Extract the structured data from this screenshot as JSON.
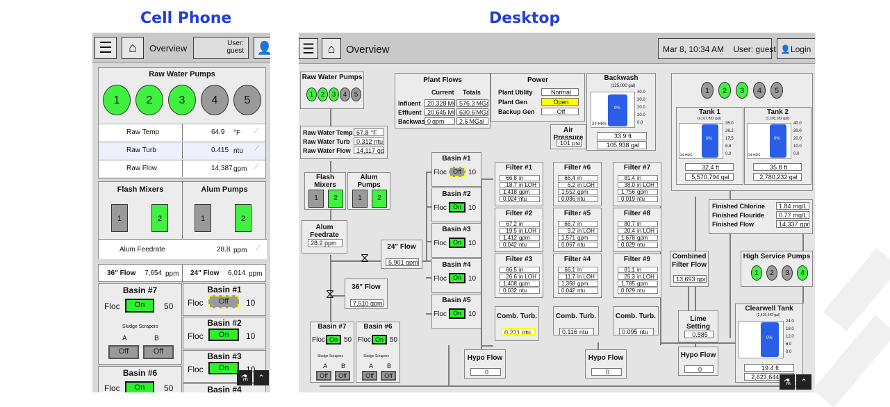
{
  "headings": {
    "cell": "Cell Phone",
    "desktop": "Desktop"
  },
  "phone": {
    "overview": "Overview",
    "user_label": "User:",
    "user_name": "guest",
    "raw_pumps_title": "Raw Water Pumps",
    "pump_numbers": [
      "1",
      "2",
      "3",
      "4",
      "5"
    ],
    "pump_colors": [
      "#3ff23f",
      "#3ff23f",
      "#3ff23f",
      "#9a9a9a",
      "#9a9a9a"
    ],
    "raw_rows": [
      {
        "label": "Raw Temp",
        "value": "64.9",
        "unit": "°F"
      },
      {
        "label": "Raw Turb",
        "value": "0.415",
        "unit": "ntu"
      },
      {
        "label": "Raw Flow",
        "value": "14,387",
        "unit": "gpm"
      }
    ],
    "flash_title": "Flash Mixers",
    "alum_title": "Alum Pumps",
    "flash": [
      "1",
      "2"
    ],
    "alum": [
      "1",
      "2"
    ],
    "feedrate_label": "Alum Feedrate",
    "feedrate_value": "28.8",
    "feedrate_unit": "ppm",
    "flow36_label": "36\" Flow",
    "flow36_value": "7,654",
    "flow36_unit": "ppm",
    "flow24_label": "24\" Flow",
    "flow24_value": "6,014",
    "flow24_unit": "ppm",
    "basin7": "Basin #7",
    "basin6": "Basin #6",
    "floc": "Floc",
    "on": "On",
    "off": "Off",
    "floc50": "50",
    "floc10": "10",
    "sludge": "Sludge Scrapers",
    "a": "A",
    "b": "B",
    "basin1": "Basin #1",
    "basin2": "Basin #2",
    "basin3": "Basin #3",
    "basin4": "Basin #4"
  },
  "desktop": {
    "overview": "Overview",
    "datetime": "Mar 8, 10:34 AM",
    "user": "User: guest",
    "login": "Login",
    "raw_pumps": "Raw Water Pumps",
    "pump_numbers": [
      "1",
      "2",
      "3",
      "4",
      "5"
    ],
    "plant_flows": "Plant Flows",
    "current": "Current",
    "totals": "Totals",
    "flows": [
      {
        "label": "Influent",
        "cur": "20.328",
        "cu": "MGD",
        "tot": "576.3",
        "tu": "MGal"
      },
      {
        "label": "Effluent",
        "cur": "20.645",
        "cu": "MGD",
        "tot": "630.6",
        "tu": "MGal"
      },
      {
        "label": "Backwash",
        "cur": "0",
        "cu": "gpm",
        "tot": "2.6",
        "tu": "MGal"
      }
    ],
    "power": "Power",
    "power_rows": [
      {
        "label": "Plant Utility",
        "value": "Normal",
        "color": "#ffffff"
      },
      {
        "label": "Plant Gen",
        "value": "Open",
        "color": "#ffff00"
      },
      {
        "label": "Backup Gen",
        "value": "Off",
        "color": "#ffffff"
      }
    ],
    "backwash": "Backwash",
    "backwash_cap": "(125,000 gal)",
    "backwash_ticks": [
      "40.0",
      "30.0",
      "20.0",
      "10.0",
      "0.0"
    ],
    "bw_pct": "0%",
    "bw_hrs": "24 HRS",
    "bw_ft": "33.9",
    "bw_gal": "105,938",
    "ft": "ft",
    "gal": "gal",
    "air_pressure": "Air Pressure",
    "air_value": "101",
    "air_unit": "psi",
    "raw_info": [
      {
        "label": "Raw Water Temp",
        "value": "67.8",
        "unit": "°F"
      },
      {
        "label": "Raw Water Turb",
        "value": "0.312",
        "unit": "ntu"
      },
      {
        "label": "Raw Water Flow",
        "value": "14,117",
        "unit": "gpm"
      }
    ],
    "flash": "Flash Mixers",
    "alum": "Alum Pumps",
    "alum_feedrate": "Alum Feedrate",
    "feedrate": "28.2",
    "ppm": "ppm",
    "flow24": "24\" Flow",
    "flow24_val": "5,901",
    "flow36": "36\" Flow",
    "flow36_val": "7,510",
    "gpm": "gpm",
    "basins": [
      {
        "name": "Basin #1",
        "state": "Off",
        "floc": "10"
      },
      {
        "name": "Basin #2",
        "state": "On",
        "floc": "10"
      },
      {
        "name": "Basin #3",
        "state": "On",
        "floc": "10"
      },
      {
        "name": "Basin #4",
        "state": "On",
        "floc": "10"
      },
      {
        "name": "Basin #5",
        "state": "On",
        "floc": "10"
      }
    ],
    "floc": "Floc",
    "basin7": "Basin #7",
    "basin6": "Basin #6",
    "floc50": "50",
    "on": "On",
    "off": "Off",
    "sludge": "Sludge Scrapers",
    "a": "A",
    "b": "B",
    "filters": [
      {
        "name": "Filter #1",
        "v": [
          "66.8",
          "18.7",
          "1,418",
          "0.024"
        ]
      },
      {
        "name": "Filter #6",
        "v": [
          "66.4",
          "6.2",
          "1,552",
          "0.036"
        ]
      },
      {
        "name": "Filter #7",
        "v": [
          "81.4",
          "38.0",
          "1,756",
          "0.019"
        ]
      },
      {
        "name": "Filter #2",
        "v": [
          "67.2",
          "19.5",
          "1,412",
          "0.042"
        ]
      },
      {
        "name": "Filter #5",
        "v": [
          "66.7",
          "9.2",
          "1,571",
          "0.067"
        ]
      },
      {
        "name": "Filter #8",
        "v": [
          "80.7",
          "20.4",
          "1,678",
          "0.029"
        ]
      },
      {
        "name": "Filter #3",
        "v": [
          "66.5",
          "26.6",
          "1,408",
          "0.032"
        ]
      },
      {
        "name": "Filter #4",
        "v": [
          "66.1",
          "11.7",
          "1,358",
          "0.042"
        ]
      },
      {
        "name": "Filter #9",
        "v": [
          "81.1",
          "25.3",
          "1,785",
          "0.029"
        ]
      }
    ],
    "filter_units": [
      "in",
      "in LOH",
      "gpm",
      "ntu"
    ],
    "comb_turb": "Comb. Turb.",
    "comb": [
      {
        "v": "0.221"
      },
      {
        "v": "0.116"
      },
      {
        "v": "0.095"
      }
    ],
    "ntu": "ntu",
    "hypo": "Hypo Flow",
    "hypo1": "0",
    "hypo2": "0",
    "hypo3": "0",
    "combined_filter": "Combined Filter Flow",
    "combined_val": "13,693",
    "lime": "Lime Setting",
    "lime_val": "0.585",
    "tank1": "Tank 1",
    "tank1_cap": "(6,017,832 gal)",
    "tank1_ticks": [
      "35.0",
      "26.2",
      "17.5",
      "8.8",
      "0.0"
    ],
    "tank1_pct": "0%",
    "tank1_ft": "32.4",
    "tank1_gal": "5,570,794",
    "tank2": "Tank 2",
    "tank2_cap": "(3,106,182 gal)",
    "tank2_ticks": [
      "40.0",
      "30.0",
      "20.0",
      "10.0",
      "0.0"
    ],
    "tank2_pct": "0%",
    "tank2_ft": "35.8",
    "tank2_gal": "2,780,232",
    "hrs": "24 HRS",
    "finished": [
      {
        "label": "Finished Chlorine",
        "value": "1.84",
        "unit": "mg/L"
      },
      {
        "label": "Finished Flouride",
        "value": "0.77",
        "unit": "mg/L"
      },
      {
        "label": "Finished Flow",
        "value": "14,337",
        "unit": "gpm"
      }
    ],
    "hs_pumps": "High Service Pumps",
    "hs_numbers": [
      "1",
      "2",
      "3",
      "4"
    ],
    "clearwell": "Clearwell Tank",
    "clearwell_cap": "(2,419,443 gal)",
    "clear_ticks": [
      "24.0",
      "18.0",
      "12.0",
      "6.0",
      "0.0"
    ],
    "clear_pct": "0%",
    "clear_ft": "19.4",
    "clear_gal": "2,623,644"
  }
}
